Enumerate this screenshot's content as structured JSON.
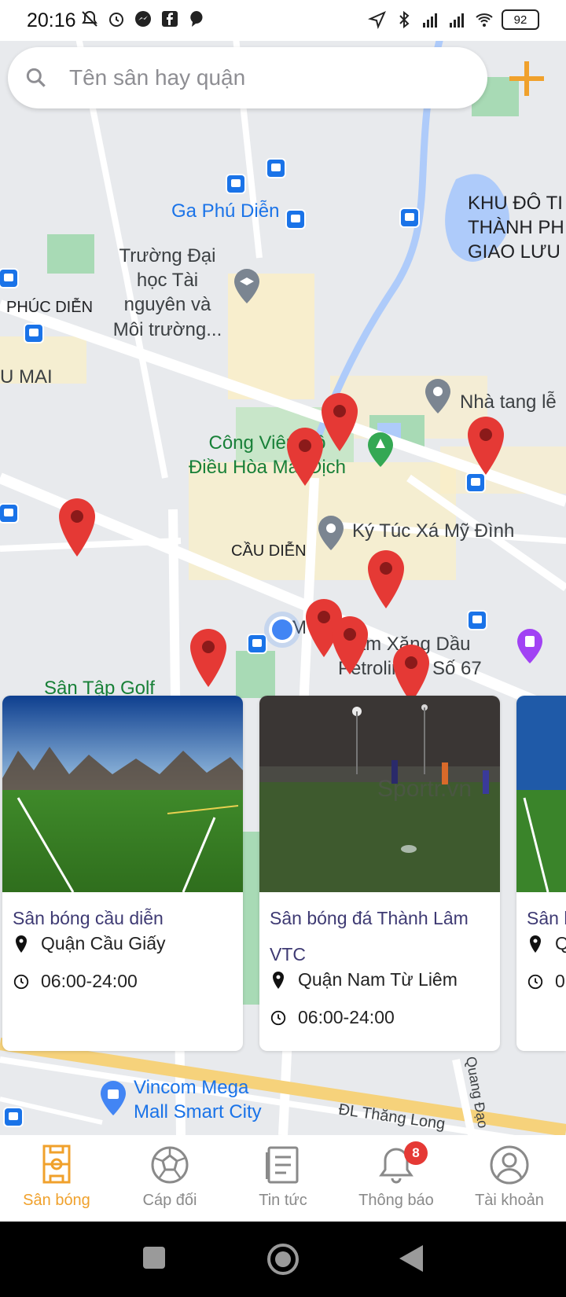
{
  "status_bar": {
    "time": "20:16",
    "battery": "92",
    "left_icons": [
      "mute-icon",
      "alarm-icon",
      "messenger-icon",
      "facebook-icon",
      "chat-bubble-icon"
    ],
    "right_icons": [
      "location-arrow-icon",
      "bluetooth-icon",
      "signal-icon",
      "signal-icon",
      "wifi-icon",
      "battery-icon"
    ]
  },
  "search": {
    "placeholder": "Tên sân hay quận"
  },
  "map": {
    "labels": {
      "khu_do_thi": "KHU ĐÔ TI\nTHÀNH PH\nGIAO LƯU",
      "ga_phu_dien": "Ga Phú Diễn",
      "truong_dai_hoc": "Trường Đại\nhọc Tài\nnguyên và\nMôi trường...",
      "phuc_dien": "PHÚC DIỄN",
      "u_mai": "U MAI",
      "nha_tang_le": "Nhà tang lễ",
      "cong_vien": "Công Viên Hồ\nĐiều Hòa Mai Dịch",
      "cau_dien": "CẦU DIỄN",
      "ky_tuc_xa": "Ký Túc Xá Mỹ Đình",
      "tram_xang": "Trạm Xăng Dầu\nPetrolimex Số 67",
      "my_dinh_2": "MỸ 2",
      "san_tap_golf": "Sân Tập Golf",
      "vincom": "Vincom Mega\nMall Smart City",
      "thang_long": "ĐL Thăng Long",
      "quang_dao": "Quang Đạo"
    }
  },
  "cards": [
    {
      "title": "Sân bóng cầu diễn",
      "district": "Quận Cầu Giấy",
      "hours": "06:00-24:00"
    },
    {
      "title": "Sân bóng đá Thành Lâm VTC",
      "district": "Quận Nam Từ Liêm",
      "hours": "06:00-24:00",
      "watermark": "Sportr.vn"
    },
    {
      "title": "Sân b",
      "district": "Qu",
      "hours": "06"
    }
  ],
  "nav": {
    "items": [
      {
        "label": "Sân bóng",
        "icon": "field-icon",
        "active": true
      },
      {
        "label": "Cáp đối",
        "icon": "soccer-ball-icon",
        "active": false
      },
      {
        "label": "Tin tức",
        "icon": "news-icon",
        "active": false
      },
      {
        "label": "Thông báo",
        "icon": "bell-icon",
        "active": false,
        "badge": "8"
      },
      {
        "label": "Tài khoản",
        "icon": "account-icon",
        "active": false
      }
    ]
  },
  "colors": {
    "accent": "#f0a12c",
    "pin": "#e53935",
    "card_title": "#3e3a73",
    "badge": "#e53935"
  }
}
